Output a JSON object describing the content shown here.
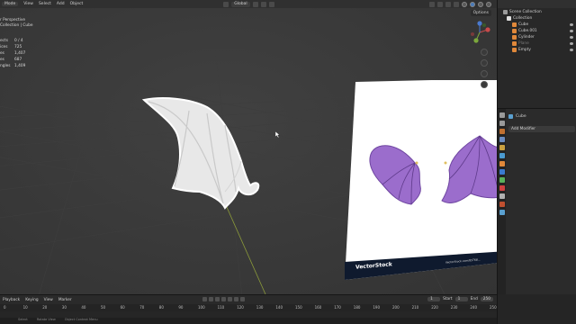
{
  "header": {
    "mode": "Mode",
    "menu": [
      "View",
      "Select",
      "Add",
      "Object"
    ],
    "transform_orientation": "Global",
    "options_label": "Options"
  },
  "viewport": {
    "info_lines": [
      "r Perspective",
      "Collection | Cube"
    ],
    "stats": [
      {
        "label": "ects",
        "value": "0 / 4"
      },
      {
        "label": "ices",
        "value": "725"
      },
      {
        "label": "es",
        "value": "1,407"
      },
      {
        "label": "es",
        "value": "687"
      },
      {
        "label": "ngles",
        "value": "1,409"
      }
    ],
    "watermark": "VectorStock",
    "watermark_id": "VectorStock.com/83768..."
  },
  "outliner": {
    "items": [
      {
        "label": "Scene Collection",
        "level": "l0",
        "color": "#9a9a9a",
        "dim": false
      },
      {
        "label": "Collection",
        "level": "l1",
        "color": "#e0e0e0",
        "dim": false
      },
      {
        "label": "Cube",
        "level": "l2",
        "color": "#e0883a",
        "dim": false
      },
      {
        "label": "Cube.001",
        "level": "l2",
        "color": "#e0883a",
        "dim": false
      },
      {
        "label": "Cylinder",
        "level": "l2",
        "color": "#e0883a",
        "dim": false
      },
      {
        "label": "Plane",
        "level": "l2",
        "color": "#e0883a",
        "dim": true
      },
      {
        "label": "Empty",
        "level": "l2",
        "color": "#e0883a",
        "dim": false
      }
    ]
  },
  "properties": {
    "object_name": "Cube",
    "add_modifier": "Add Modifier",
    "tab_colors": [
      "#9a9a9a",
      "#9a9a9a",
      "#c07030",
      "#6a8cc0",
      "#c9a040",
      "#4a9ad0",
      "#e0883a",
      "#3a7ad0",
      "#5ab05a",
      "#d04040",
      "#b0b0b0",
      "#c05030",
      "#5aa0d0"
    ]
  },
  "timeline": {
    "menu": [
      "Playback",
      "Keying",
      "View",
      "Marker"
    ],
    "current_frame": "1",
    "start_label": "Start",
    "start_value": "1",
    "end_label": "End",
    "end_value": "250",
    "ruler": [
      "0",
      "10",
      "20",
      "30",
      "40",
      "50",
      "60",
      "70",
      "80",
      "90",
      "100",
      "110",
      "120",
      "130",
      "140",
      "150",
      "160",
      "170",
      "180",
      "190",
      "200",
      "210",
      "220",
      "230",
      "240",
      "250"
    ]
  },
  "status_bar": [
    "Select",
    "Rotate View",
    "Object Context Menu"
  ]
}
